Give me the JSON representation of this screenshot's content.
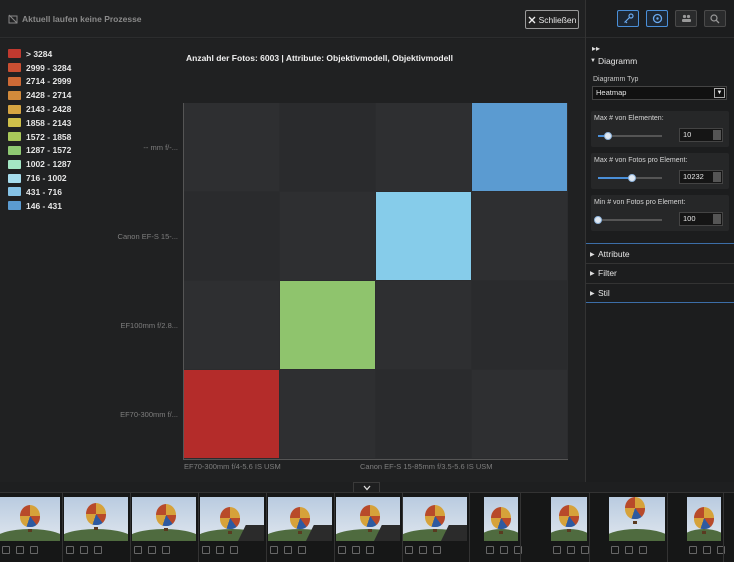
{
  "status": {
    "text": "Aktuell laufen keine Prozesse"
  },
  "close_button": {
    "label": "Schließen"
  },
  "legend": [
    {
      "label": "> 3284",
      "color": "#c0392f"
    },
    {
      "label": "2999 - 3284",
      "color": "#c94f32"
    },
    {
      "label": "2714 - 2999",
      "color": "#cd6a36"
    },
    {
      "label": "2428 - 2714",
      "color": "#d18a3b"
    },
    {
      "label": "2143 - 2428",
      "color": "#d6a542"
    },
    {
      "label": "1858 - 2143",
      "color": "#cfc04a"
    },
    {
      "label": "1572 - 1858",
      "color": "#a9c95a"
    },
    {
      "label": "1287 - 1572",
      "color": "#8fc973"
    },
    {
      "label": "1002 - 1287",
      "color": "#a4e6c4"
    },
    {
      "label": "716 - 1002",
      "color": "#a6dcec"
    },
    {
      "label": "431 - 716",
      "color": "#86c3e6"
    },
    {
      "label": "146 - 431",
      "color": "#5b9bd1"
    }
  ],
  "chart_data": {
    "type": "heatmap",
    "title": "Anzahl der Fotos: 6003 | Attribute: Objektivmodell, Objektivmodell",
    "y_categories": [
      "-- mm f/-...",
      "Canon EF-S 15-...",
      "EF100mm f/2.8...",
      "EF70-300mm f/..."
    ],
    "x_tick_labels": [
      "EF70-300mm f/4-5.6 IS USM",
      "Canon EF-S 15-85mm f/3.5-5.6 IS USM"
    ],
    "cells": [
      {
        "row": 0,
        "col": 3,
        "bin": "146 - 431",
        "color": "#5b9bd1"
      },
      {
        "row": 1,
        "col": 2,
        "bin": "716 - 1002",
        "color": "#86ccea"
      },
      {
        "row": 2,
        "col": 1,
        "bin": "1287 - 1572",
        "color": "#8fc46d"
      },
      {
        "row": 3,
        "col": 0,
        "bin": "> 3284",
        "color": "#b42c2a"
      }
    ],
    "grid_size": 4,
    "legend_position": "left"
  },
  "panel": {
    "diagram_section": "Diagramm",
    "chart_type_label": "Diagramm Typ",
    "chart_type_value": "Heatmap",
    "sliders": [
      {
        "label": "Max # von Elementen:",
        "value": "10",
        "fraction": 0.15
      },
      {
        "label": "Max # von Fotos pro Element:",
        "value": "10232",
        "fraction": 0.53
      },
      {
        "label": "Min # von Fotos pro Element:",
        "value": "100",
        "fraction": 0.0
      }
    ],
    "sections": [
      "Attribute",
      "Filter",
      "Stil"
    ]
  }
}
